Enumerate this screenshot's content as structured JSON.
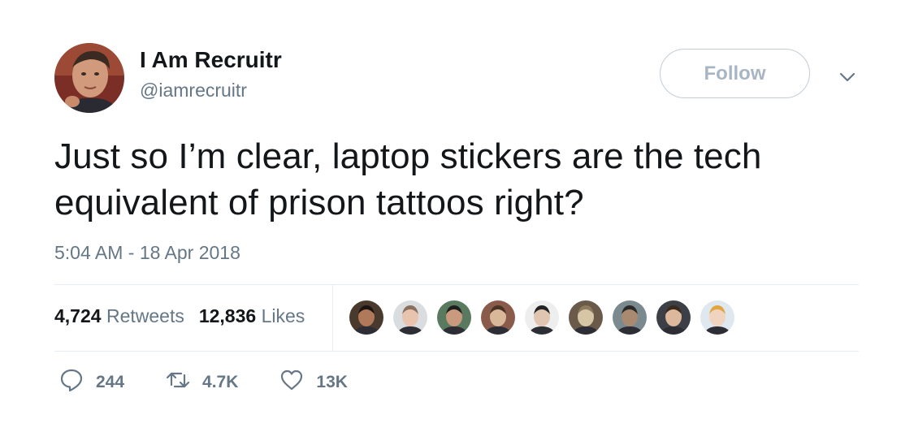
{
  "author": {
    "display_name": "I Am Recruitr",
    "handle": "@iamrecruitr"
  },
  "follow_label": "Follow",
  "tweet": {
    "text": "Just so I’m clear, laptop stickers are the tech equivalent of prison tattoos right?",
    "timestamp": "5:04 AM - 18 Apr 2018"
  },
  "stats": {
    "retweets_count": "4,724",
    "retweets_label": "Retweets",
    "likes_count": "12,836",
    "likes_label": "Likes"
  },
  "likers": [
    {
      "name": "liker-avatar",
      "skin": "#b07a5a",
      "bg": "#4a3a2e",
      "hair": "#1b1410"
    },
    {
      "name": "liker-avatar",
      "skin": "#e8c4ae",
      "bg": "#d9dde0",
      "hair": "#8a6f5e"
    },
    {
      "name": "liker-avatar",
      "skin": "#c99a7e",
      "bg": "#5a7a5f",
      "hair": "#1e1e1e"
    },
    {
      "name": "liker-avatar",
      "skin": "#d9b89a",
      "bg": "#8a5a4a",
      "hair": "#4a3326"
    },
    {
      "name": "liker-avatar",
      "skin": "#e0c5b0",
      "bg": "#eeeeee",
      "hair": "#222222"
    },
    {
      "name": "liker-avatar",
      "skin": "#d7c6a6",
      "bg": "#6a5a4a",
      "hair": "#8e7a5e"
    },
    {
      "name": "liker-avatar",
      "skin": "#a98a70",
      "bg": "#7a8a8e",
      "hair": "#2a2a2a"
    },
    {
      "name": "liker-avatar",
      "skin": "#dcb89c",
      "bg": "#3c3f46",
      "hair": "#3a2a1e"
    },
    {
      "name": "liker-avatar",
      "skin": "#f0d4c0",
      "bg": "#dfe8ee",
      "hair": "#e0a640"
    }
  ],
  "actions": {
    "replies": "244",
    "retweets": "4.7K",
    "likes": "13K"
  },
  "colors": {
    "text": "#14171a",
    "secondary": "#657786",
    "divider": "#e6ecf0",
    "follow_border": "#c4cdd5"
  },
  "icons": [
    "reply-icon",
    "retweet-icon",
    "heart-icon",
    "chevron-down-icon"
  ]
}
